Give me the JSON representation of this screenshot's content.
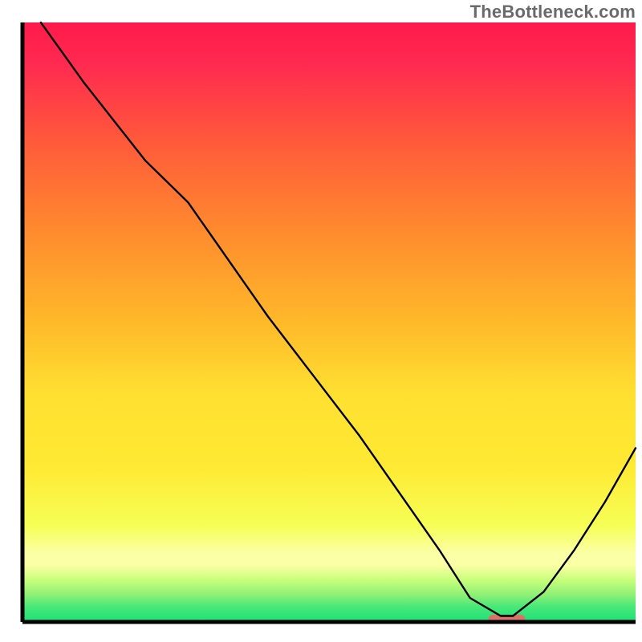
{
  "watermark": "TheBottleneck.com",
  "chart_data": {
    "type": "line",
    "title": "",
    "xlabel": "",
    "ylabel": "",
    "xlim": [
      0,
      100
    ],
    "ylim": [
      0,
      100
    ],
    "grid": false,
    "legend": false,
    "series": [
      {
        "name": "curve",
        "x": [
          3,
          10,
          20,
          27,
          40,
          55,
          68,
          73,
          78,
          80,
          85,
          90,
          95,
          100
        ],
        "y": [
          100,
          90,
          77,
          70,
          51,
          31,
          12,
          4,
          1,
          1,
          5,
          12,
          20,
          29
        ]
      }
    ],
    "marker": {
      "name": "optimal-marker",
      "x": 79,
      "y": 0.5,
      "width_pct": 6,
      "height_pct": 1.4,
      "color": "#d9736a"
    },
    "background": {
      "top_color": "#ff1a4b",
      "mid_color": "#ffe933",
      "band_color": "#fbffa5",
      "bottom_color": "#1fe07a"
    }
  }
}
